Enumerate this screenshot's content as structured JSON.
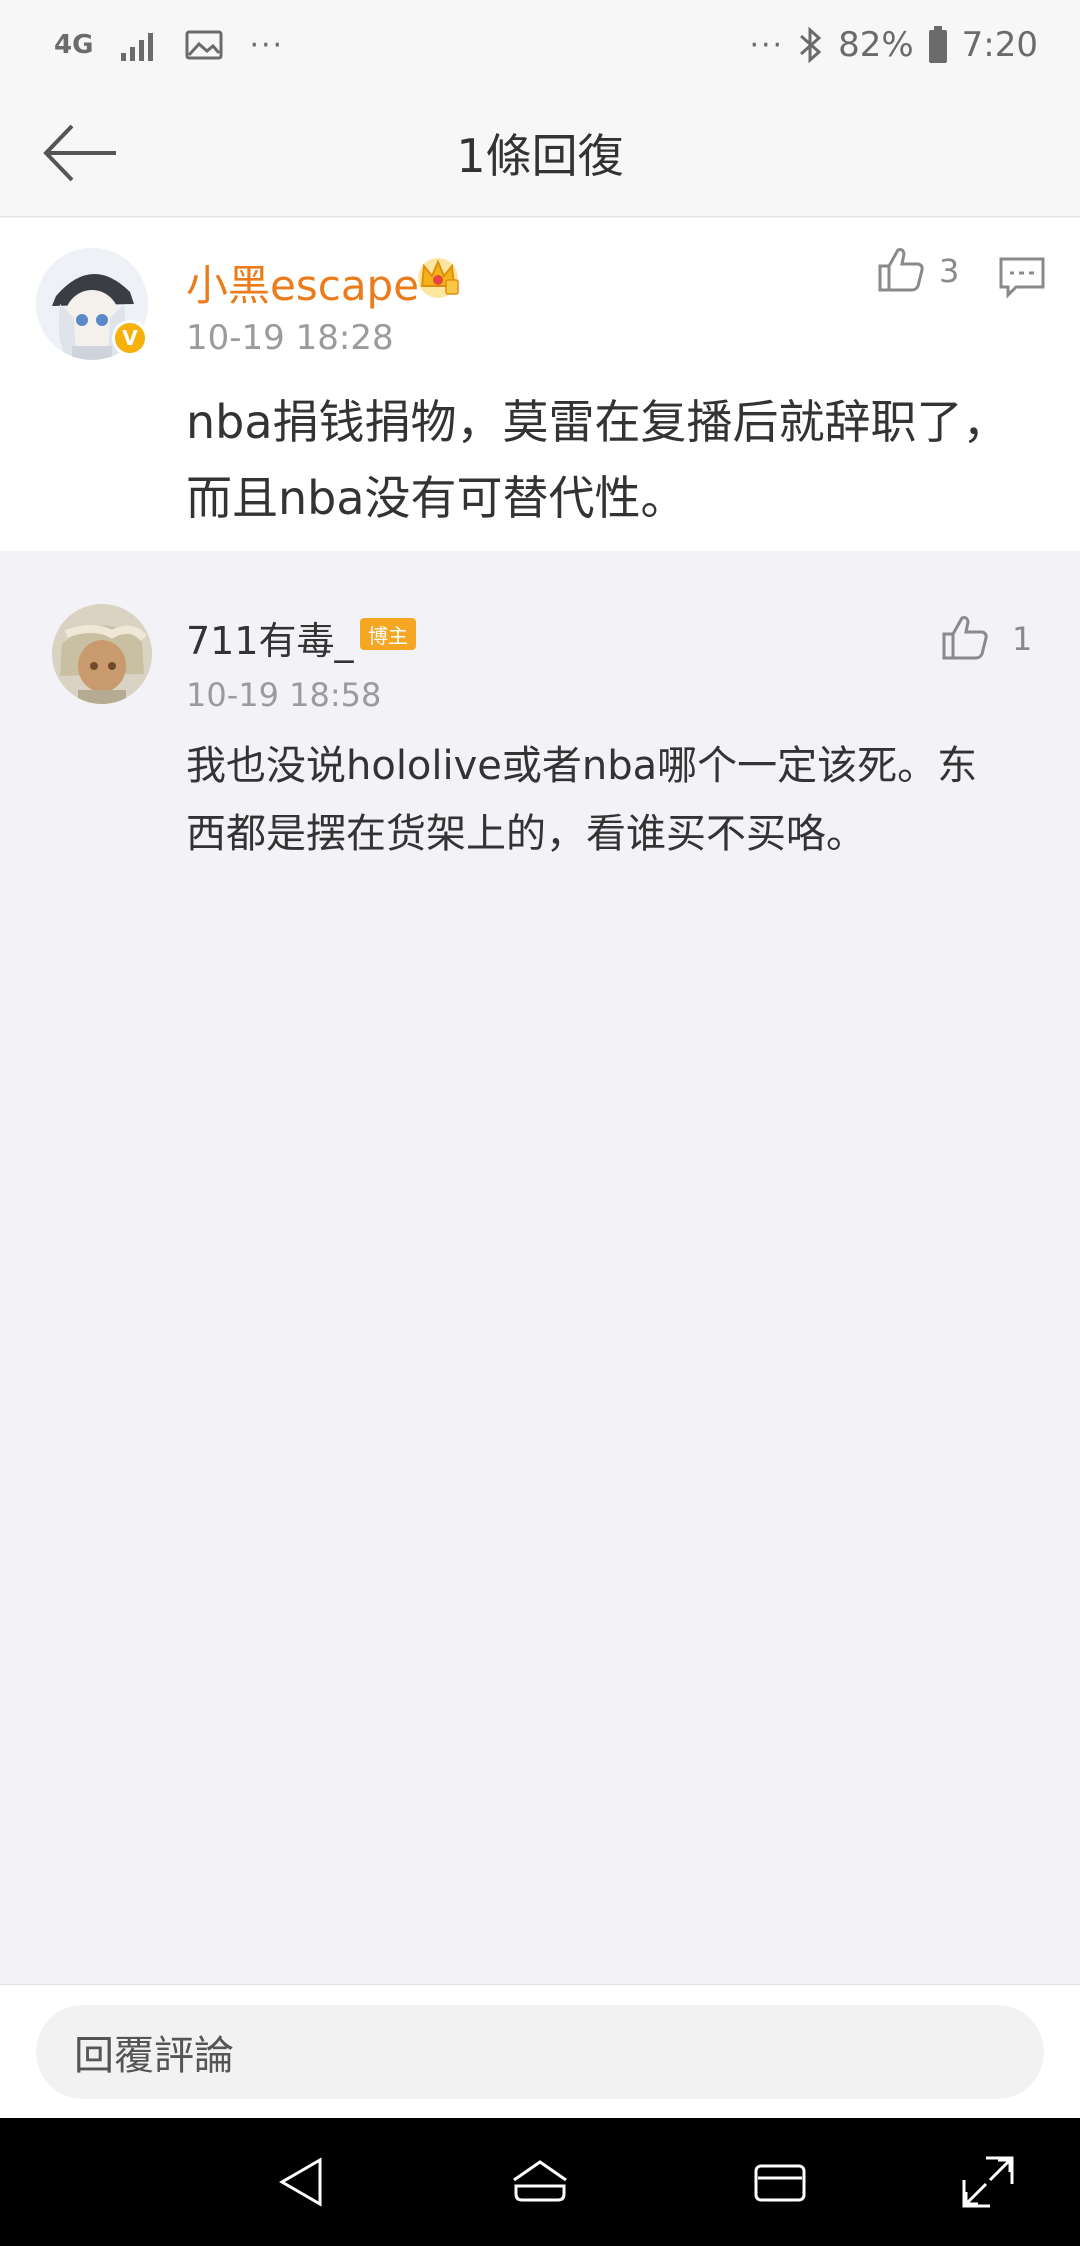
{
  "status_bar": {
    "network": "4G",
    "battery": "82%",
    "time": "7:20",
    "left_more": "···",
    "right_more": "···"
  },
  "header": {
    "title": "1條回復"
  },
  "main_comment": {
    "username": "小黑escape",
    "timestamp": "10-19 18:28",
    "text": "nba捐钱捐物，莫雷在复播后就辞职了，而且nba没有可替代性。",
    "likes": "3",
    "verified_mark": "V"
  },
  "reply": {
    "username": "711有毒_",
    "badge": "博主",
    "timestamp": "10-19 18:58",
    "text": "我也没说hololive或者nba哪个一定该死。东西都是摆在货架上的，看谁买不买咯。",
    "likes": "1"
  },
  "reply_bar": {
    "placeholder": "回覆評論"
  },
  "colors": {
    "username_accent": "#eb7c1b",
    "badge": "#f5a623",
    "verified": "#f6b10b"
  }
}
